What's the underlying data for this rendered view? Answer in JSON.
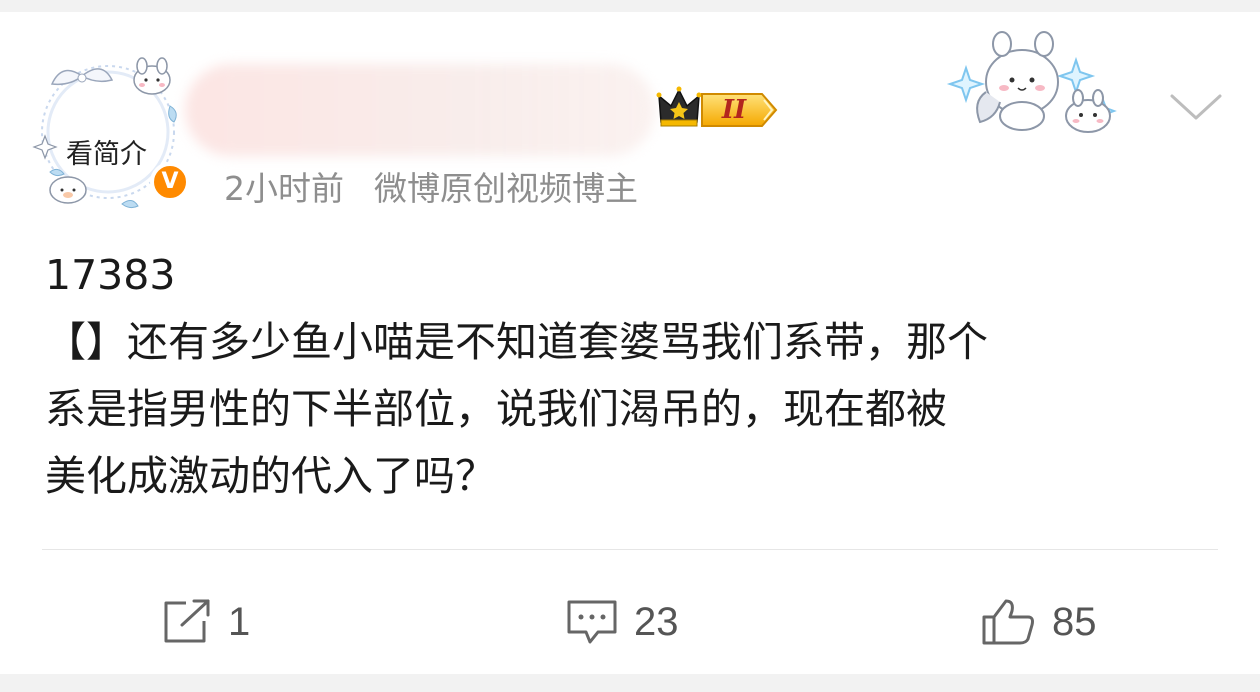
{
  "header": {
    "avatar_label": "看简介",
    "verified_badge": "V",
    "vip_level": "II",
    "time_ago": "2小时前",
    "source": "微博原创视频博主"
  },
  "post": {
    "lines": [
      "17383",
      "【】还有多少鱼小喵是不知道套婆骂我们系带，那个",
      "系是指男性的下半部位，说我们渴吊的，现在都被",
      "美化成激动的代入了吗？"
    ]
  },
  "actions": {
    "repost_count": "1",
    "comment_count": "23",
    "like_count": "85"
  },
  "colors": {
    "verified": "#ff8a00",
    "vip_gold": "#f5b800",
    "meta_text": "#8e8e8e",
    "body_text": "#1a1a1a"
  },
  "icons": [
    "verified-icon",
    "crown-icon",
    "chevron-down-icon",
    "repost-icon",
    "comment-icon",
    "like-icon"
  ]
}
